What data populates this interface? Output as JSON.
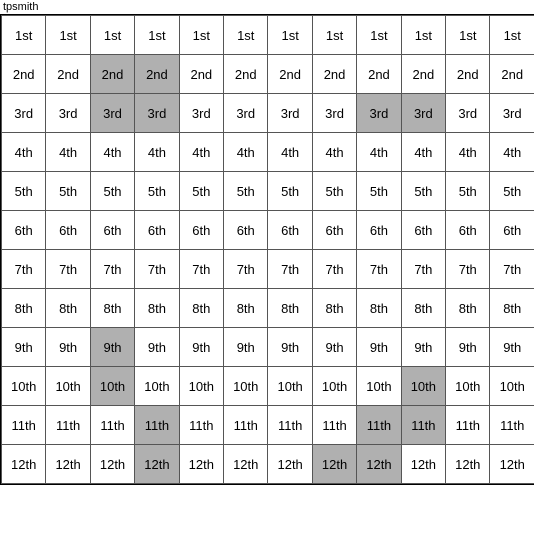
{
  "title": "tpsmith",
  "rows": [
    [
      "1st",
      "1st",
      "1st",
      "1st",
      "1st",
      "1st",
      "1st",
      "1st",
      "1st",
      "1st",
      "1st",
      "1st"
    ],
    [
      "2nd",
      "2nd",
      "2nd",
      "2nd",
      "2nd",
      "2nd",
      "2nd",
      "2nd",
      "2nd",
      "2nd",
      "2nd",
      "2nd"
    ],
    [
      "3rd",
      "3rd",
      "3rd",
      "3rd",
      "3rd",
      "3rd",
      "3rd",
      "3rd",
      "3rd",
      "3rd",
      "3rd",
      "3rd"
    ],
    [
      "4th",
      "4th",
      "4th",
      "4th",
      "4th",
      "4th",
      "4th",
      "4th",
      "4th",
      "4th",
      "4th",
      "4th"
    ],
    [
      "5th",
      "5th",
      "5th",
      "5th",
      "5th",
      "5th",
      "5th",
      "5th",
      "5th",
      "5th",
      "5th",
      "5th"
    ],
    [
      "6th",
      "6th",
      "6th",
      "6th",
      "6th",
      "6th",
      "6th",
      "6th",
      "6th",
      "6th",
      "6th",
      "6th"
    ],
    [
      "7th",
      "7th",
      "7th",
      "7th",
      "7th",
      "7th",
      "7th",
      "7th",
      "7th",
      "7th",
      "7th",
      "7th"
    ],
    [
      "8th",
      "8th",
      "8th",
      "8th",
      "8th",
      "8th",
      "8th",
      "8th",
      "8th",
      "8th",
      "8th",
      "8th"
    ],
    [
      "9th",
      "9th",
      "9th",
      "9th",
      "9th",
      "9th",
      "9th",
      "9th",
      "9th",
      "9th",
      "9th",
      "9th"
    ],
    [
      "10th",
      "10th",
      "10th",
      "10th",
      "10th",
      "10th",
      "10th",
      "10th",
      "10th",
      "10th",
      "10th",
      "10th"
    ],
    [
      "11th",
      "11th",
      "11th",
      "11th",
      "11th",
      "11th",
      "11th",
      "11th",
      "11th",
      "11th",
      "11th",
      "11th"
    ],
    [
      "12th",
      "12th",
      "12th",
      "12th",
      "12th",
      "12th",
      "12th",
      "12th",
      "12th",
      "12th",
      "12th",
      "12th"
    ]
  ],
  "highlights": {
    "1-2": true,
    "1-3": true,
    "2-2": true,
    "2-3": true,
    "2-8": true,
    "2-9": true,
    "8-2": true,
    "9-2": true,
    "9-9": true,
    "10-3": true,
    "10-8": true,
    "10-9": true,
    "11-3": true,
    "11-7": true,
    "11-8": true,
    "12-4": true,
    "12-5": true,
    "12-6": true,
    "12-7": true
  }
}
